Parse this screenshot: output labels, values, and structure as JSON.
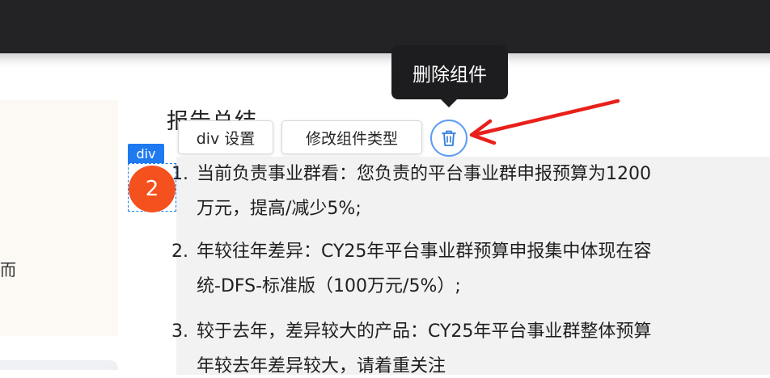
{
  "toolbar": {
    "settings_label": "div 设置",
    "change_type_label": "修改组件类型",
    "delete_tooltip": "删除组件"
  },
  "selection": {
    "tag": "div",
    "badge_number": "2"
  },
  "left_panel": {
    "fragment": "而"
  },
  "summary": {
    "heading": "报告总结",
    "items": [
      {
        "num": "1.",
        "line1": "当前负责事业群看：您负责的平台事业群申报预算为1200",
        "line2": "万元，提高/减少5%;"
      },
      {
        "num": "2.",
        "line1": "年较往年差异：CY25年平台事业群预算申报集中体现在容",
        "line2": "统-DFS-标准版（100万元/5%）;"
      },
      {
        "num": "3.",
        "line1": "较于去年，差异较大的产品：CY25年平台事业群整体预算",
        "line2": "年较去年差异较大，请着重关注"
      }
    ]
  },
  "colors": {
    "accent": "#1f7af0",
    "badge": "#f4511e",
    "annotation_arrow": "#e8201a",
    "topbar": "#232326"
  },
  "icons": {
    "delete": "trash-icon",
    "annotation": "red-arrow"
  }
}
